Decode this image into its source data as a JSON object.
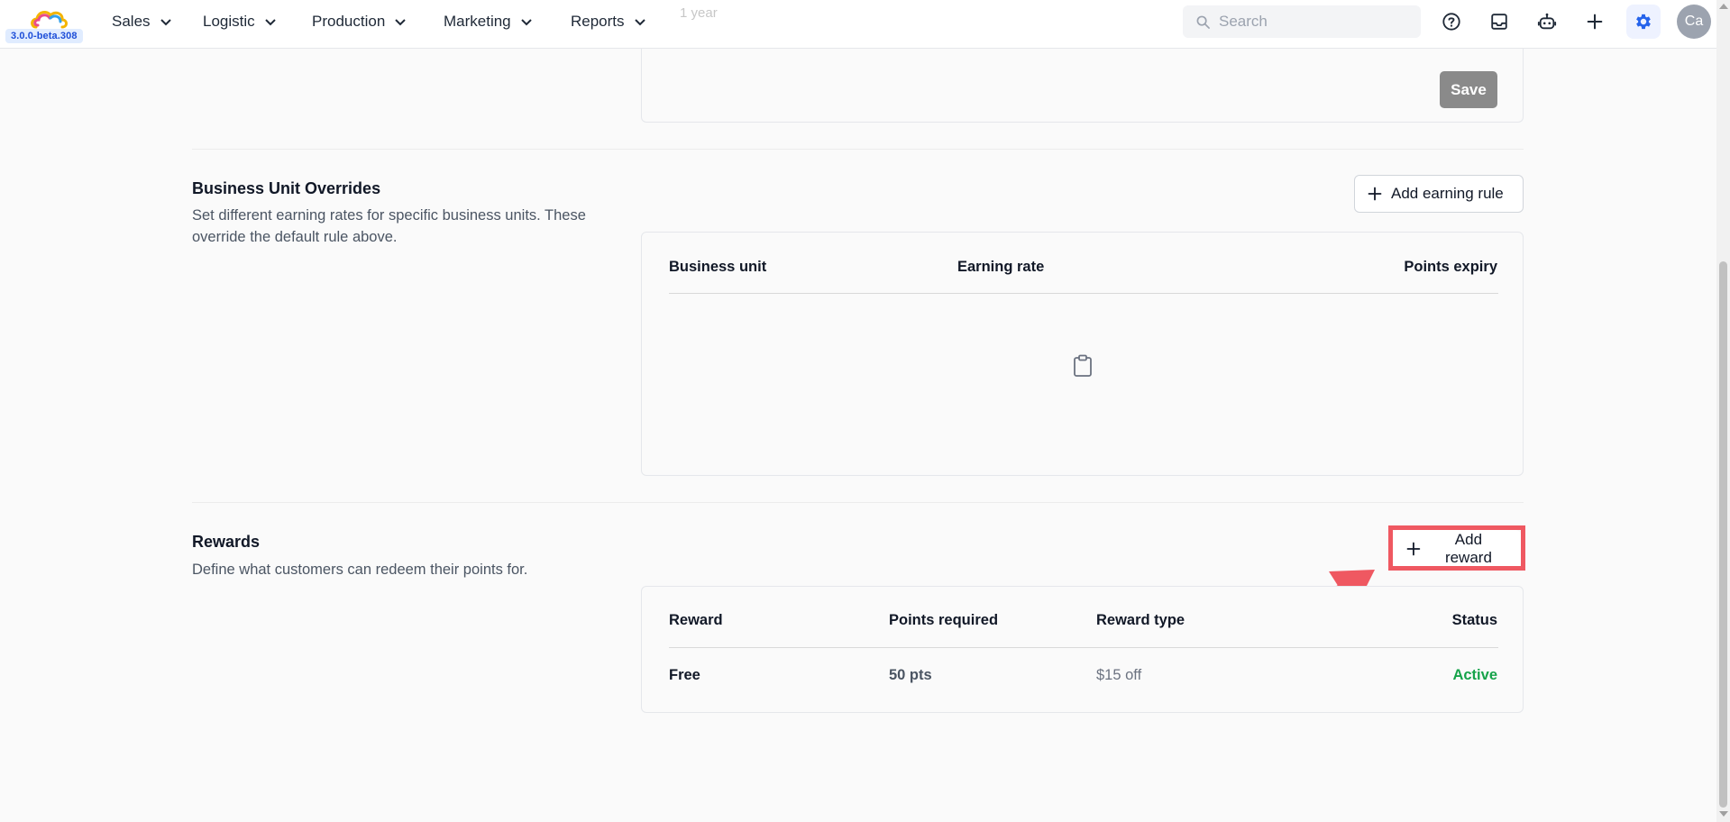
{
  "app": {
    "version": "3.0.0-beta.308"
  },
  "nav": {
    "items": [
      {
        "label": "Sales"
      },
      {
        "label": "Logistic"
      },
      {
        "label": "Production"
      },
      {
        "label": "Marketing"
      },
      {
        "label": "Reports"
      }
    ]
  },
  "search": {
    "placeholder": "Search"
  },
  "user": {
    "initials": "Ca"
  },
  "scrolled_remnant": "1 year",
  "default_rule": {
    "save_label": "Save"
  },
  "business_unit_overrides": {
    "title": "Business Unit Overrides",
    "description": "Set different earning rates for specific business units. These override the default rule above.",
    "add_button_label": "Add earning rule",
    "columns": [
      "Business unit",
      "Earning rate",
      "Points expiry"
    ],
    "rows": [],
    "empty_icon": "clipboard-icon"
  },
  "rewards": {
    "title": "Rewards",
    "description": "Define what customers can redeem their points for.",
    "add_button_label": "Add reward",
    "columns": [
      "Reward",
      "Points required",
      "Reward type",
      "Status"
    ],
    "rows": [
      {
        "reward": "Free",
        "points_required": "50 pts",
        "reward_type": "$15 off",
        "status": "Active"
      }
    ]
  },
  "colors": {
    "accent": "#2563eb",
    "status_active": "#16a34a",
    "highlight": "#ef5861",
    "save_disabled": "#8a8a8a"
  }
}
